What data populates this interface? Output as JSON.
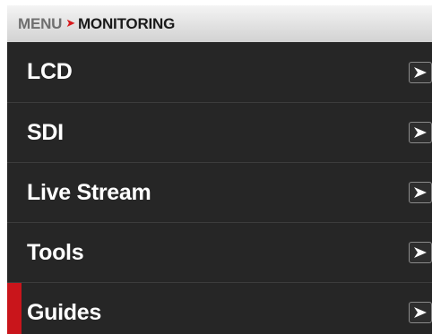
{
  "breadcrumb": {
    "parent": "MENU",
    "separator": "➤",
    "current": "MONITORING"
  },
  "menu": {
    "items": [
      {
        "label": "LCD",
        "icon": "chevron-right-icon",
        "selected": false
      },
      {
        "label": "SDI",
        "icon": "chevron-right-icon",
        "selected": false
      },
      {
        "label": "Live Stream",
        "icon": "chevron-right-icon",
        "selected": false
      },
      {
        "label": "Tools",
        "icon": "chevron-right-icon",
        "selected": false
      },
      {
        "label": "Guides",
        "icon": "chevron-right-icon",
        "selected": true
      }
    ]
  },
  "colors": {
    "accent": "#c9151b",
    "panel_bg": "#262626",
    "text": "#ffffff"
  }
}
